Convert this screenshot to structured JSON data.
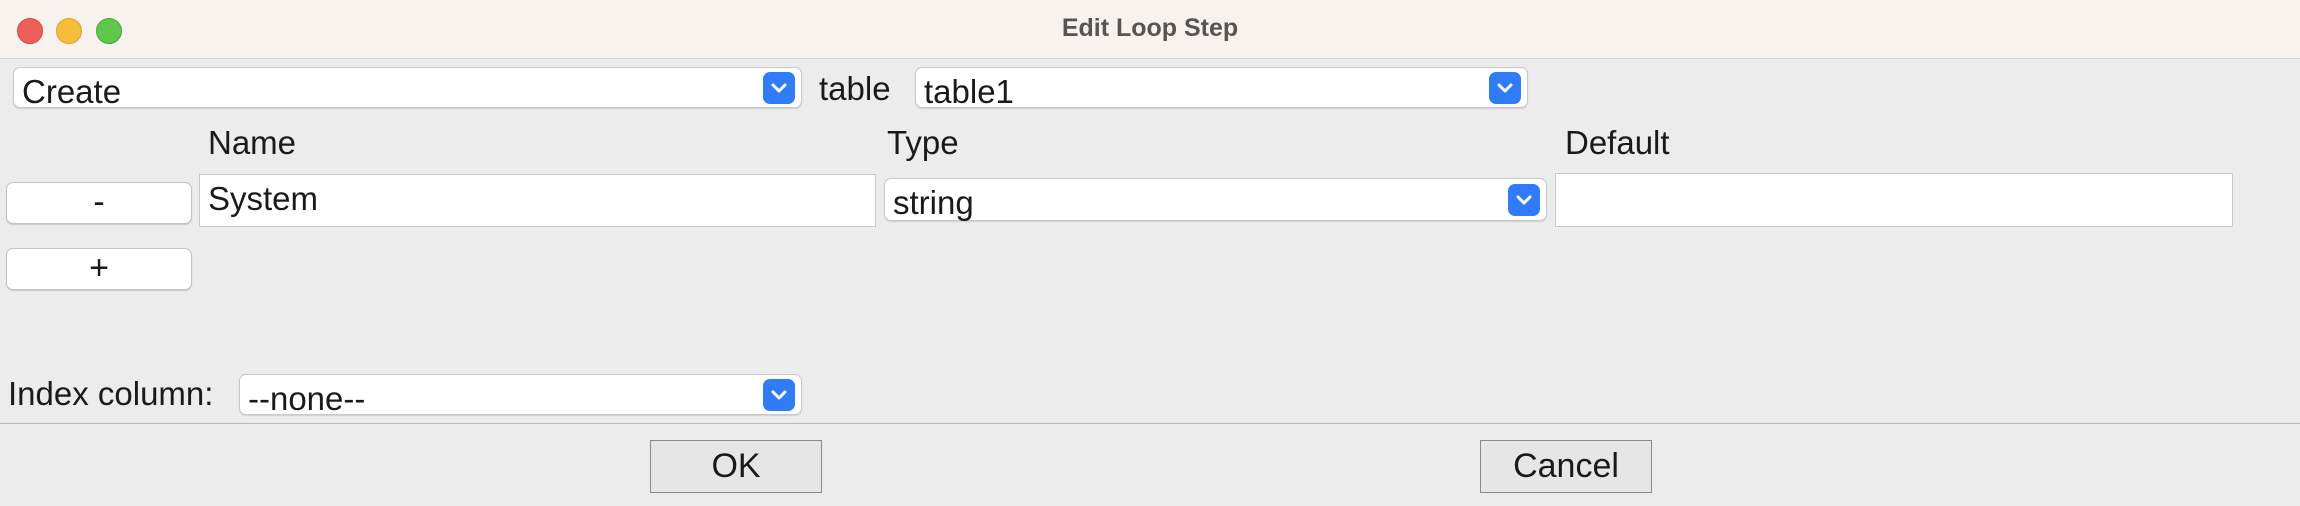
{
  "window": {
    "title": "Edit Loop Step"
  },
  "action": {
    "selected": "Create"
  },
  "table": {
    "label": "table",
    "selected": "table1"
  },
  "columns_header": {
    "name": "Name",
    "type": "Type",
    "default": "Default"
  },
  "rows": [
    {
      "remove_label": "-",
      "name": "System",
      "type": "string",
      "default": ""
    }
  ],
  "add_label": "+",
  "index": {
    "label": "Index column:",
    "selected": "--none--"
  },
  "buttons": {
    "ok": "OK",
    "cancel": "Cancel"
  },
  "colors": {
    "accent": "#2f7cf6",
    "close": "#ee5f57",
    "minimize": "#f6bd3b",
    "maximize": "#5fc84b"
  }
}
